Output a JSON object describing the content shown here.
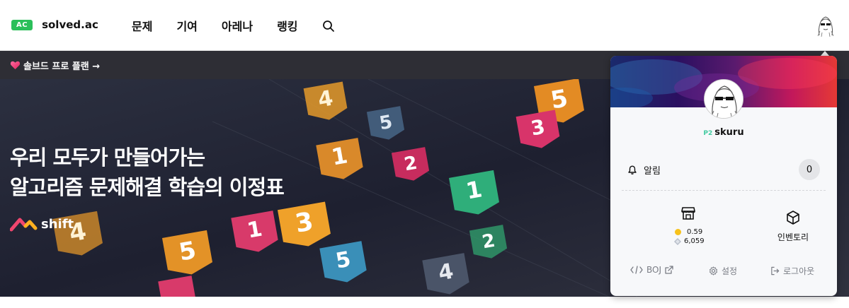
{
  "header": {
    "logo_badge": "AC",
    "logo_text": "solved.ac",
    "nav": [
      "문제",
      "기여",
      "아레나",
      "랭킹"
    ]
  },
  "promo": {
    "text": "솔브드 프로 플랜 →"
  },
  "hero": {
    "line1": "우리 모두가 만들어가는",
    "line2": "알고리즘 문제해결 학습의 이정표",
    "brand": "shift"
  },
  "profile_panel": {
    "tier": "P2",
    "username": "skuru",
    "notification_label": "알림",
    "notification_count": "0",
    "coins": "0.59",
    "stardust": "6,059",
    "inventory_label": "인벤토리",
    "boj_label": "BOJ",
    "settings_label": "설정",
    "logout_label": "로그아웃"
  },
  "colors": {
    "accent": "#2bbf5a",
    "promo_bg": "#2e2e35",
    "hero_bg": "#26283a",
    "tier_platinum": "#41caa0"
  }
}
